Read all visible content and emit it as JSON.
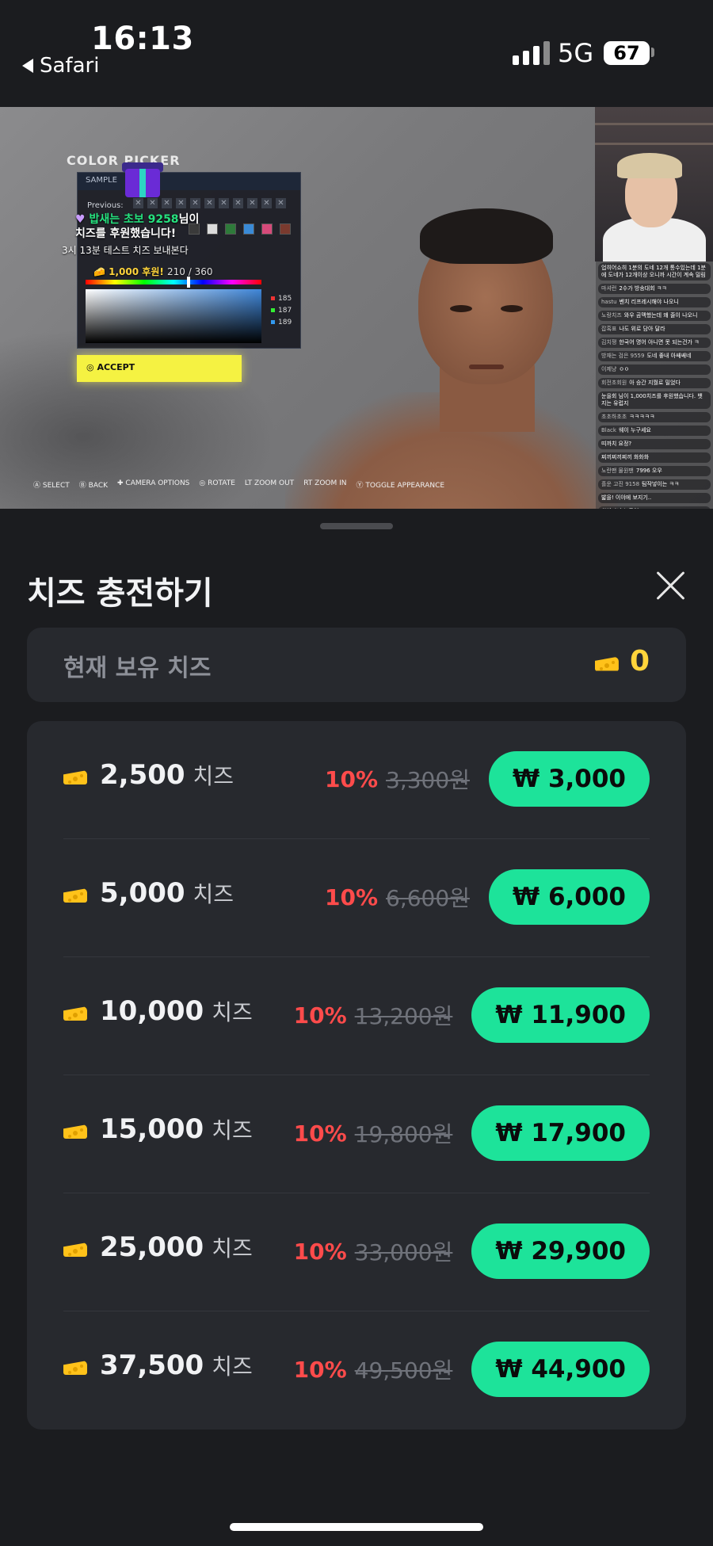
{
  "status": {
    "time": "16:13",
    "back_app": "Safari",
    "network": "5G",
    "battery": "67"
  },
  "stream": {
    "color_title": "COLOR PICKER",
    "panel_header": "SAMPLE",
    "previous_label": "Previous:",
    "donation_user": "밥새는 초보 9258",
    "donation_suffix": "님이",
    "donation_line2": "치즈를 후원했습니다!",
    "donation_message": "3시 13분 테스트 치즈 보내본다",
    "donation_amount": "1,000 후원!",
    "donation_counter": "210 / 360",
    "rgb_values": [
      "185",
      "187",
      "189"
    ],
    "accept_label": "ACCEPT",
    "hints": [
      "SELECT",
      "BACK",
      "CAMERA OPTIONS",
      "ROTATE",
      "ZOOM OUT",
      "ZOOM IN",
      "TOGGLE APPEARANCE"
    ],
    "chat": [
      {
        "nick": "",
        "text": "업히어쇼히 1분의 도네 12개 통수있는데 1분에 도네가 12개이상 오니까 시간이 계속 밀림"
      },
      {
        "nick": "마셔런",
        "text": "2수가 방송대회 ㅋㅋ"
      },
      {
        "nick": "hastu",
        "text": "벤치 리프레시해야 나오니"
      },
      {
        "nick": "노랑치즈",
        "text": "와우 곰맥했는데 왜 줄이 나오니"
      },
      {
        "nick": "잡혹표",
        "text": "나도 위로 담아 달라"
      },
      {
        "nick": "김치쟁",
        "text": "한국어 명어 아니면 못 되는건가 ㅋ"
      },
      {
        "nick": "방재는 검은 9559",
        "text": "도네 좋내 아쌔쌔네"
      },
      {
        "nick": "이제냥",
        "text": "ㅇㅇ"
      },
      {
        "nick": "회전초회원",
        "text": "아 승간 지월로 밀었다"
      },
      {
        "nick": "",
        "text": "눈을회 님이 1,000치즈를 후원했습니다. 뱃지는 유럽지"
      },
      {
        "nick": "초초하초초",
        "text": "ㅋㅋㅋㅋㅋ"
      },
      {
        "nick": "Black",
        "text": "웨이 누구세요"
      },
      {
        "nick": "",
        "text": "띠까치 요정?"
      },
      {
        "nick": "",
        "text": "찌끼찌끼찌끼 화화화"
      },
      {
        "nick": "노란팬 물원팬",
        "text": "7996 오우"
      },
      {
        "nick": "흘운 고진 9158",
        "text": "팀작넣이는 ㅋㅋ"
      },
      {
        "nick": "",
        "text": "밟을! 이야에 보지기.."
      },
      {
        "nick": "",
        "text": "화방짜나 누구여 ㅋㅋ"
      }
    ]
  },
  "sheet": {
    "title": "치즈 충전하기",
    "balance_label": "현재 보유 치즈",
    "balance_value": "0",
    "unit": "치즈",
    "items": [
      {
        "amount": "2,500",
        "discount": "10%",
        "original": "3,300원",
        "price": "₩ 3,000"
      },
      {
        "amount": "5,000",
        "discount": "10%",
        "original": "6,600원",
        "price": "₩ 6,000"
      },
      {
        "amount": "10,000",
        "discount": "10%",
        "original": "13,200원",
        "price": "₩ 11,900"
      },
      {
        "amount": "15,000",
        "discount": "10%",
        "original": "19,800원",
        "price": "₩ 17,900"
      },
      {
        "amount": "25,000",
        "discount": "10%",
        "original": "33,000원",
        "price": "₩ 29,900"
      },
      {
        "amount": "37,500",
        "discount": "10%",
        "original": "49,500원",
        "price": "₩ 44,900"
      }
    ]
  },
  "colors": {
    "accent_green": "#1de39a",
    "discount_red": "#ff4b4b",
    "cheese_yellow": "#ffd43b",
    "background": "#1b1c1f",
    "card": "#27292e"
  }
}
